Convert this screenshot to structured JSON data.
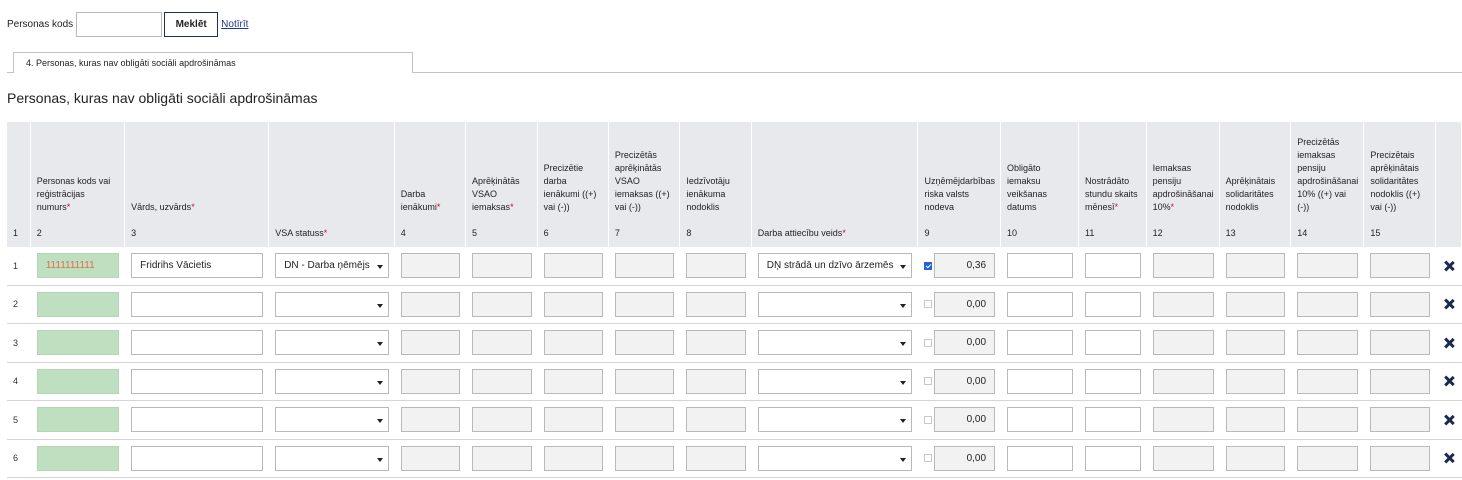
{
  "search": {
    "label": "Personas kods",
    "value": "",
    "search_button": "Meklēt",
    "clear_link": "Notīrīt"
  },
  "tab": {
    "label": "4. Personas, kuras nav obligāti sociāli apdrošināmas"
  },
  "section_title": "Personas, kuras nav obligāti sociāli apdrošināmas",
  "columns": [
    {
      "header": "",
      "number": "1"
    },
    {
      "header": "Personas kods vai reģistrācijas numurs",
      "required": true,
      "number": "2"
    },
    {
      "header": "Vārds, uzvārds",
      "required": true,
      "number": "3"
    },
    {
      "header": "",
      "number": "VSA statuss",
      "number_required": true
    },
    {
      "header": "Darba ienākumi",
      "required": true,
      "number": "4"
    },
    {
      "header": "Aprēķinātās VSAO iemaksas",
      "required": true,
      "number": "5"
    },
    {
      "header": "Precizētie darba ienākumi ((+) vai (-))",
      "number": "6"
    },
    {
      "header": "Precizētās aprēķinātās VSAO iemaksas ((+) vai (-))",
      "number": "7"
    },
    {
      "header": "Iedzīvotāju ienākuma nodoklis",
      "number": "8"
    },
    {
      "header": "",
      "number": "Darba attiecību veids",
      "number_required": true
    },
    {
      "header": "Uzņēmējdarbības riska valsts nodeva",
      "number": "9"
    },
    {
      "header": "Obligāto iemaksu veikšanas datums",
      "number": "10"
    },
    {
      "header": "Nostrādāto stundu skaits mēnesī",
      "required": true,
      "number": "11"
    },
    {
      "header": "Iemaksas pensiju apdrošināšanai 10%",
      "required": true,
      "number": "12"
    },
    {
      "header": "Aprēķinātais solidaritātes nodoklis",
      "number": "13"
    },
    {
      "header": "Precizētās iemaksas pensiju apdrošināšanai 10% ((+) vai (-))",
      "number": "14"
    },
    {
      "header": "Precizētais aprēķinātais solidaritātes nodoklis ((+) vai (-))",
      "number": "15"
    }
  ],
  "rows": [
    {
      "num": "1",
      "personal_code": "1111111111",
      "name": "Fridrihs Vācietis",
      "vsa_status": "DN - Darba ņēmējs",
      "employment_type": "DŅ strādā un dzīvo ārzemēs",
      "risk_checked": true,
      "risk_value": "0,36"
    },
    {
      "num": "2",
      "personal_code": "",
      "name": "",
      "vsa_status": "",
      "employment_type": "",
      "risk_checked": false,
      "risk_value": "0,00"
    },
    {
      "num": "3",
      "personal_code": "",
      "name": "",
      "vsa_status": "",
      "employment_type": "",
      "risk_checked": false,
      "risk_value": "0,00"
    },
    {
      "num": "4",
      "personal_code": "",
      "name": "",
      "vsa_status": "",
      "employment_type": "",
      "risk_checked": false,
      "risk_value": "0,00"
    },
    {
      "num": "5",
      "personal_code": "",
      "name": "",
      "vsa_status": "",
      "employment_type": "",
      "risk_checked": false,
      "risk_value": "0,00"
    },
    {
      "num": "6",
      "personal_code": "",
      "name": "",
      "vsa_status": "",
      "employment_type": "",
      "risk_checked": false,
      "risk_value": "0,00"
    }
  ],
  "icons": {
    "delete": "close-icon",
    "dropdown": "caret-down-icon"
  },
  "colors": {
    "header_bg": "#e8e9ed",
    "code_field_bg": "#bfe0c0",
    "required_mark": "#c8102e",
    "delete_icon": "#1b2a4e",
    "checkbox_on": "#2860d8"
  }
}
